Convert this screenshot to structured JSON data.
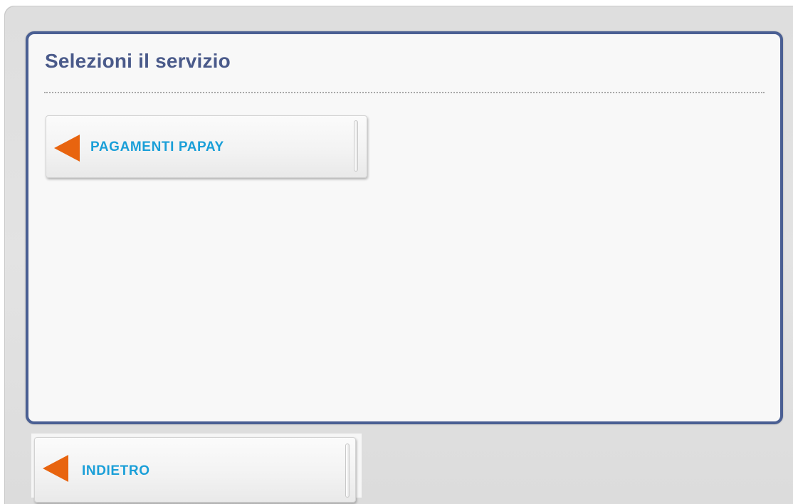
{
  "panel": {
    "title": "Selezioni il servizio"
  },
  "services": [
    {
      "label": "PAGAMENTI PAPAY",
      "icon": "arrow-left-icon"
    }
  ],
  "navigation": {
    "back_label": "INDIETRO",
    "icon": "arrow-left-icon"
  },
  "colors": {
    "panel_border": "#4a5f93",
    "title_text": "#4a5a8a",
    "button_text": "#1a9fd8",
    "arrow": "#e8640f",
    "background": "#e0e0e0"
  }
}
